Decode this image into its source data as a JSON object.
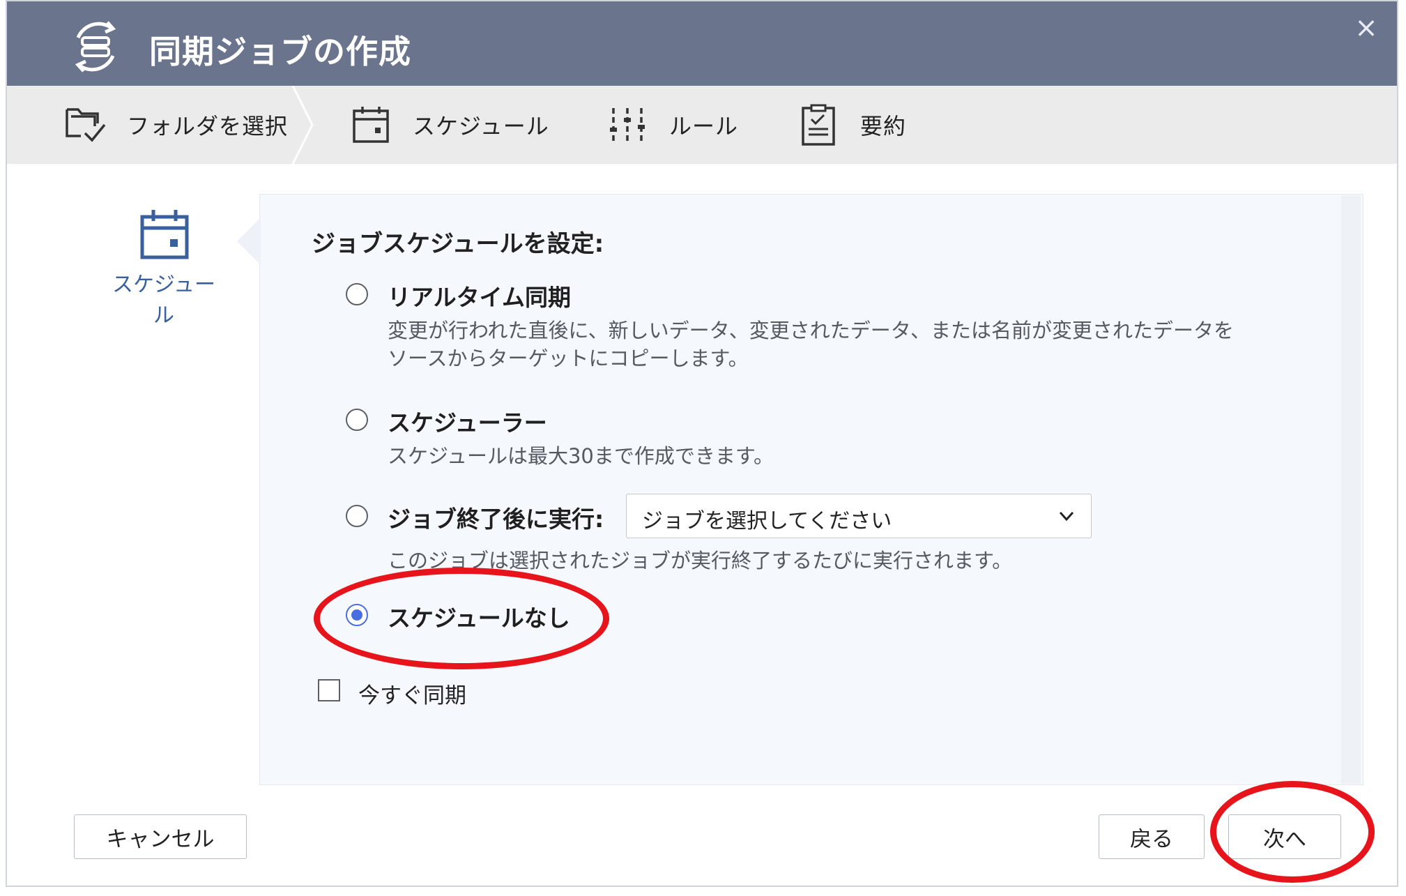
{
  "dialog": {
    "title": "同期ジョブの作成",
    "close_glyph": "×"
  },
  "steps": [
    {
      "label": "フォルダを選択",
      "icon": "folder-check-icon"
    },
    {
      "label": "スケジュール",
      "icon": "calendar-icon",
      "active": true
    },
    {
      "label": "ルール",
      "icon": "sliders-icon"
    },
    {
      "label": "要約",
      "icon": "clipboard-icon"
    }
  ],
  "side": {
    "label": "スケジュール",
    "icon": "calendar-icon"
  },
  "main": {
    "section_title": "ジョブスケジュールを設定:",
    "options": [
      {
        "label": "リアルタイム同期",
        "desc_line1": "変更が行われた直後に、新しいデータ、変更されたデータ、または名前が変更されたデータを",
        "desc_line2": "ソースからターゲットにコピーします。",
        "checked": false
      },
      {
        "label": "スケジューラー",
        "desc_line1": "スケジュールは最大30まで作成できます。",
        "checked": false
      },
      {
        "label": "ジョブ終了後に実行:",
        "select_value": "ジョブを選択してください",
        "desc_line1": "このジョブは選択されたジョブが実行終了するたびに実行されます。",
        "checked": false
      },
      {
        "label": "スケジュールなし",
        "checked": true
      }
    ],
    "sync_now_label": "今すぐ同期",
    "sync_now_checked": false
  },
  "footer": {
    "cancel_label": "キャンセル",
    "back_label": "戻る",
    "next_label": "次へ"
  },
  "colors": {
    "header_bg": "#6b748d",
    "accent": "#4a6ee0",
    "annotation": "#e8141b"
  }
}
